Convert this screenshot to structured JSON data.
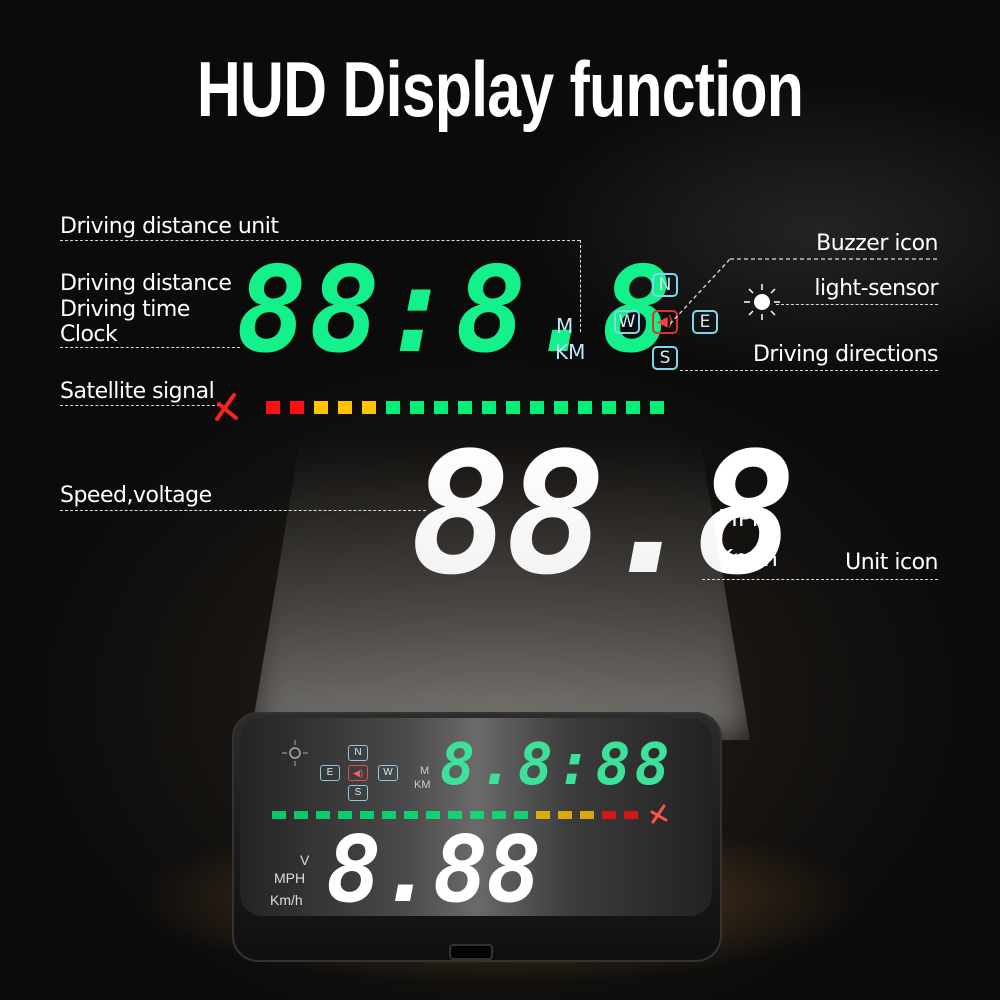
{
  "title": "HUD Display function",
  "labels": {
    "driving_distance_unit": "Driving distance unit",
    "driving_distance": "Driving distance",
    "driving_time": "Driving time",
    "clock": "Clock",
    "satellite_signal": "Satellite signal",
    "speed_voltage": "Speed,voltage",
    "buzzer_icon": "Buzzer icon",
    "light_sensor": "light-sensor",
    "driving_directions": "Driving directions",
    "unit_icon": "Unit icon"
  },
  "top_display": {
    "digits": "88:8.8",
    "units": [
      "M",
      "KM"
    ],
    "color": "#14f08a"
  },
  "compass": {
    "north": "N",
    "south": "S",
    "east": "E",
    "west": "W",
    "buzzer_glyph": "🔊",
    "icons": [
      "sun-icon",
      "speaker-icon",
      "satellite-icon"
    ]
  },
  "signal_bar": {
    "colors": [
      "#ff1010",
      "#ff1010",
      "#ffc400",
      "#ffc400",
      "#ffc400",
      "#00f07a",
      "#00f07a",
      "#00f07a",
      "#00f07a",
      "#00f07a",
      "#00f07a",
      "#00f07a",
      "#00f07a",
      "#00f07a",
      "#00f07a",
      "#00f07a",
      "#00f07a"
    ]
  },
  "speed_display": {
    "digits": "88.8",
    "units": [
      "V",
      "MPH",
      "Km/h"
    ]
  },
  "device": {
    "top_digits": "8.8:88",
    "units": [
      "M",
      "KM"
    ],
    "compass": [
      "N",
      "E",
      "W",
      "S"
    ],
    "speed_digits": "8.88",
    "speed_units": [
      "V",
      "MPH",
      "Km/h"
    ]
  }
}
